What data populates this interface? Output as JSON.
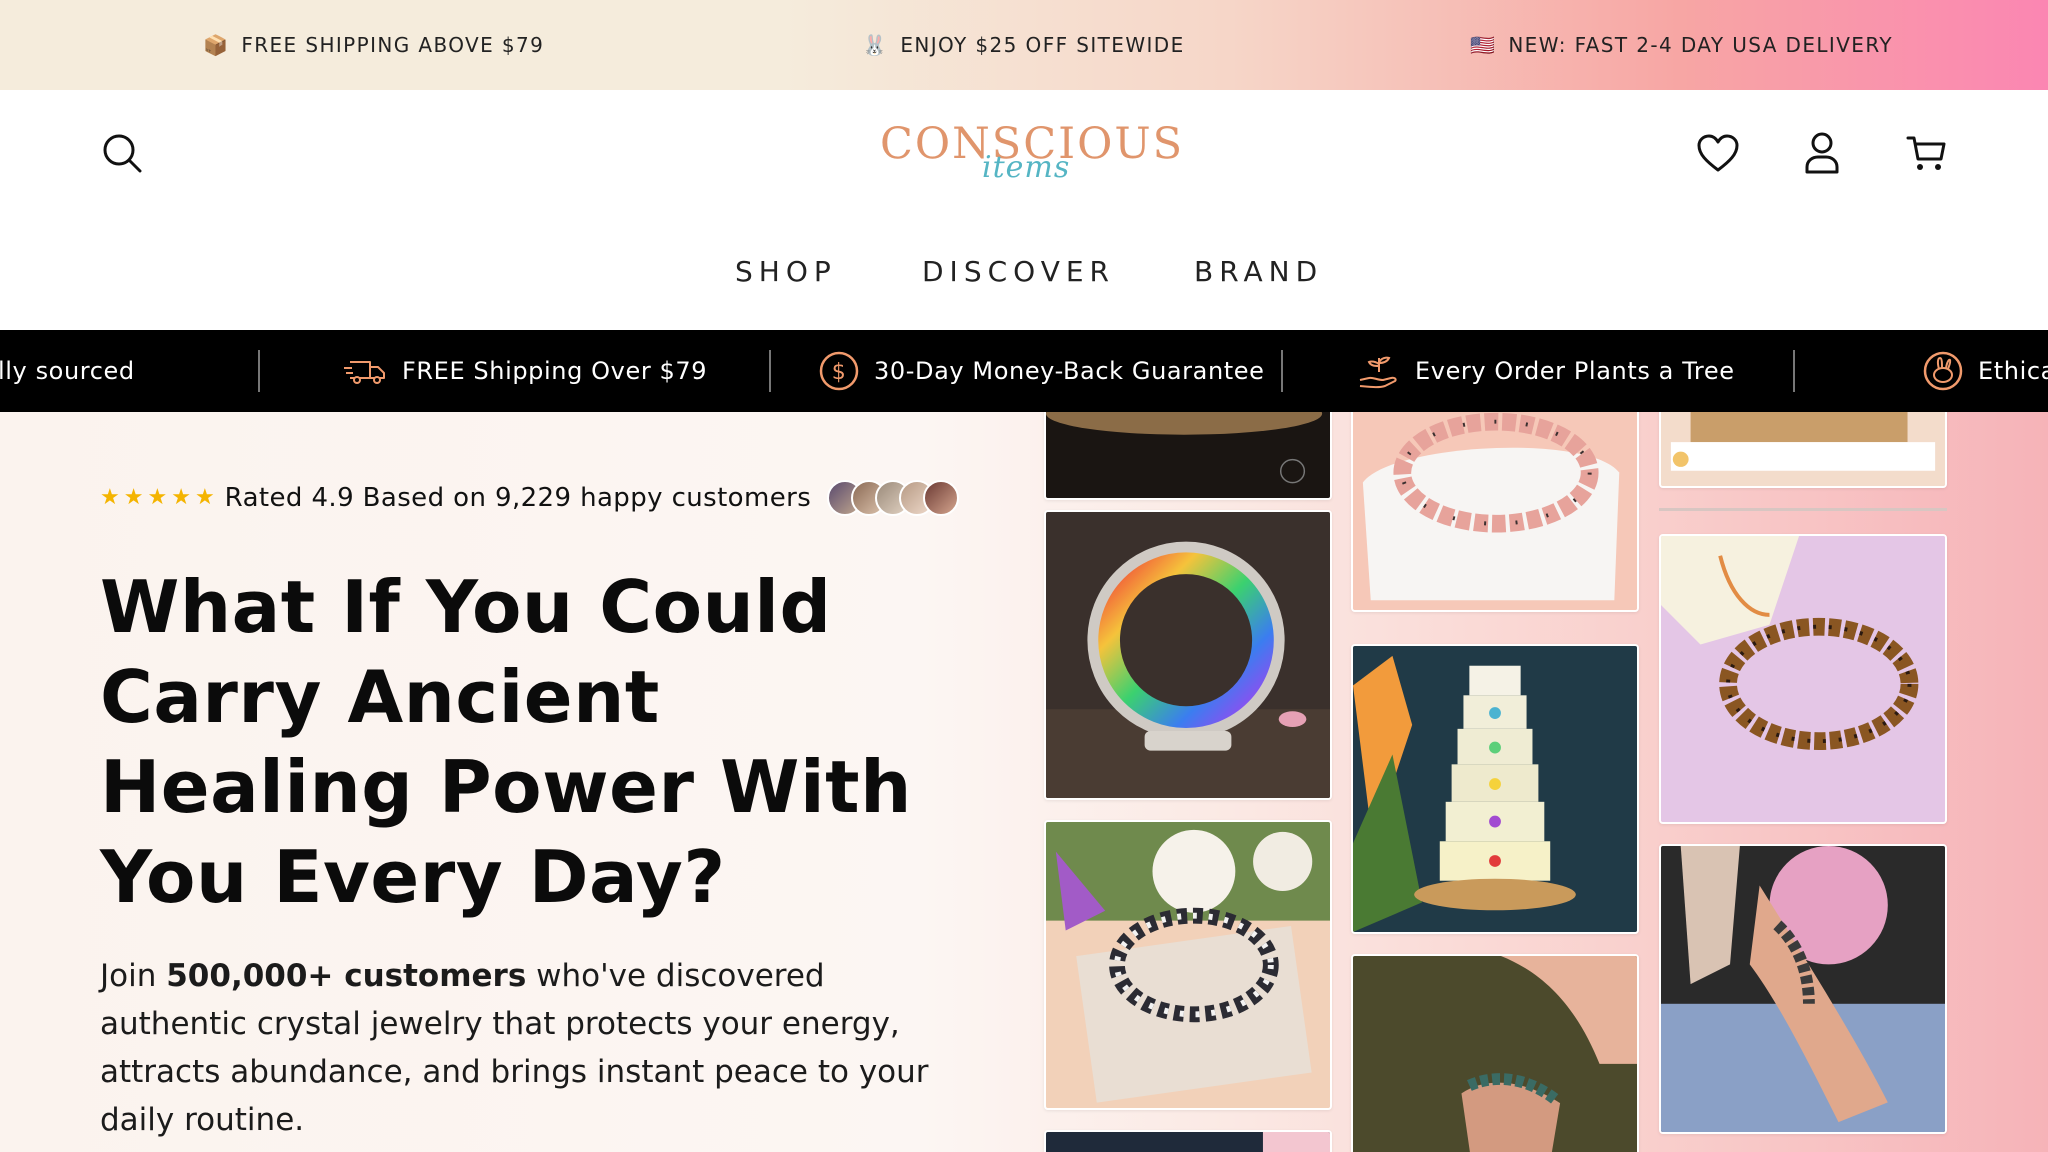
{
  "announcement": {
    "items": [
      {
        "emoji": "📦",
        "text": "FREE SHIPPING ABOVE $79"
      },
      {
        "emoji": "🐰",
        "text": "ENJOY $25 OFF SITEWIDE"
      },
      {
        "emoji": "🇺🇸",
        "text": "NEW: FAST 2-4 DAY USA DELIVERY"
      }
    ]
  },
  "header": {
    "logo_word": "CONSCIOUS",
    "logo_script": "items",
    "icons": [
      "search-icon",
      "heart-icon",
      "user-icon",
      "cart-icon"
    ]
  },
  "nav": {
    "items": [
      "SHOP",
      "DISCOVER",
      "BRAND"
    ]
  },
  "trust_bar": {
    "items": [
      "lly sourced",
      "FREE Shipping Over $79",
      "30-Day Money-Back Guarantee",
      "Every Order Plants a Tree",
      "Ethica"
    ]
  },
  "hero": {
    "rating_text": "Rated 4.9 Based on 9,229 happy customers",
    "stars": 5,
    "headline": "What If You Could Carry Ancient Healing Power With You Every Day?",
    "sub_prefix": "Join ",
    "sub_bold": "500,000+ customers",
    "sub_rest": " who've discovered authentic crystal jewelry that protects your energy, attracts abundance, and brings instant peace to your daily routine."
  },
  "colors": {
    "accent_logo": "#e0956c",
    "accent_script": "#55b5c4",
    "star": "#f4b400"
  }
}
